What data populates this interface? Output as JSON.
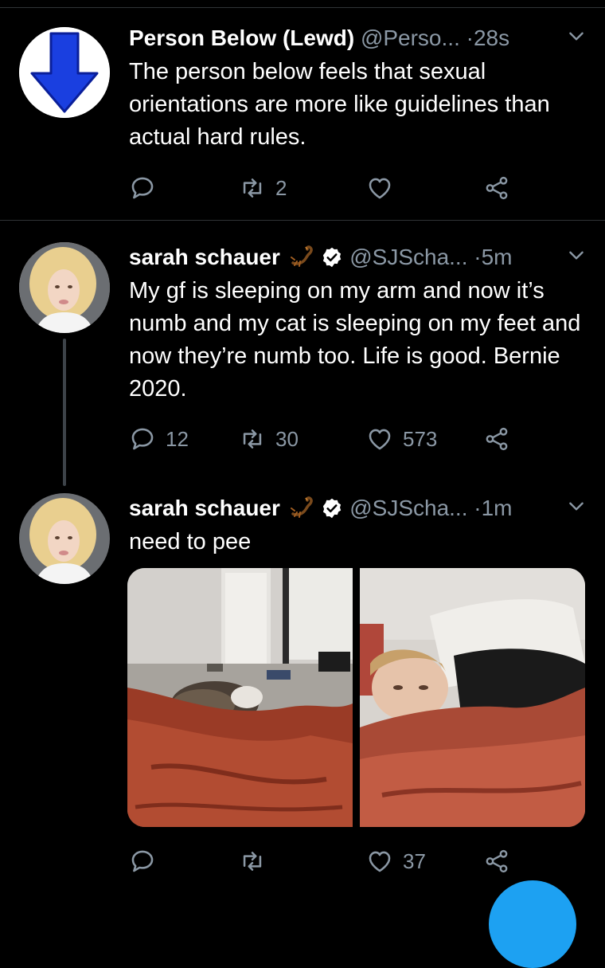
{
  "tweets": [
    {
      "name": "Person Below (Lewd)",
      "handle": "@Perso...",
      "time": "28s",
      "text": "The person below feels that sexual orientations are more like guidelines than actual hard rules.",
      "replies": "",
      "retweets": "2",
      "likes": ""
    },
    {
      "name": "sarah schauer",
      "handle": "@SJScha...",
      "time": "5m",
      "text": "My gf is sleeping on my arm and now it’s numb and my cat is sleeping on my feet and now they’re numb too. Life is good. Bernie 2020.",
      "replies": "12",
      "retweets": "30",
      "likes": "573"
    },
    {
      "name": "sarah schauer",
      "handle": "@SJScha...",
      "time": "1m",
      "text": "need to pee",
      "replies": "",
      "retweets": "",
      "likes": "37"
    }
  ],
  "separator": "·",
  "icons": {
    "reply": "reply-icon",
    "retweet": "retweet-icon",
    "like": "heart-icon",
    "share": "share-icon",
    "menu": "chevron-down-icon",
    "verified": "verified-badge-icon",
    "emoji": "scorpion-icon"
  },
  "colors": {
    "background": "#000000",
    "secondary_text": "#8b98a5",
    "divider": "#2f3336",
    "accent": "#1da1f2"
  }
}
